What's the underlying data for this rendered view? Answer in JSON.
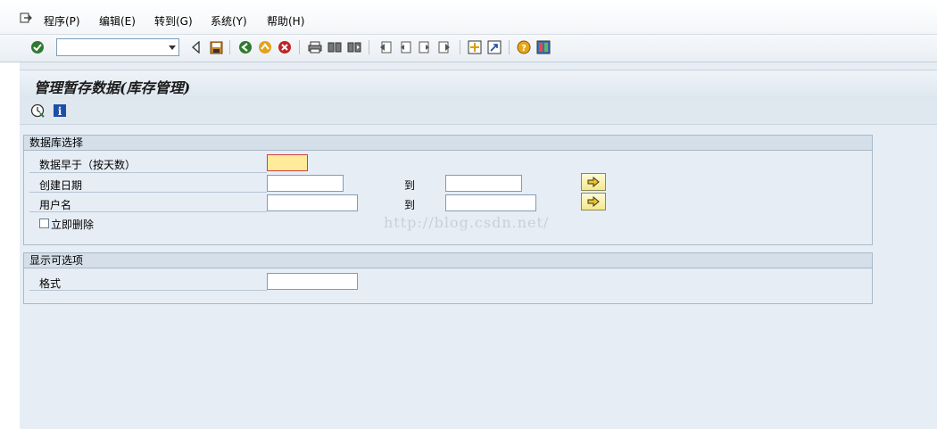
{
  "menubar": {
    "items": [
      "程序(P)",
      "编辑(E)",
      "转到(G)",
      "系统(Y)",
      "帮助(H)"
    ]
  },
  "toolbar": {
    "command_field_value": "",
    "icons": [
      "enter-icon",
      "back-icon",
      "save-icon",
      "back-green-icon",
      "exit-icon",
      "cancel-icon",
      "print-icon",
      "find-icon",
      "find-next-icon",
      "first-page-icon",
      "previous-page-icon",
      "next-page-icon",
      "last-page-icon",
      "create-session-icon",
      "shortcut-icon",
      "help-icon",
      "customize-layout-icon"
    ]
  },
  "screen": {
    "title": "管理暂存数据(库存管理)",
    "app_toolbar_icons": [
      "execute-icon",
      "info-icon"
    ]
  },
  "db_selection": {
    "header": "数据库选择",
    "older_than_label": "数据早于（按天数）",
    "older_than_value": "",
    "created_on_label": "创建日期",
    "created_on_from": "",
    "to_label_1": "到",
    "created_on_to": "",
    "username_label": "用户名",
    "username_from": "",
    "to_label_2": "到",
    "username_to": "",
    "delete_immediately_label": "立即删除",
    "delete_immediately_checked": false
  },
  "display_options": {
    "header": "显示可选项",
    "layout_label": "格式",
    "layout_value": ""
  },
  "watermark": "http://blog.csdn.net/"
}
